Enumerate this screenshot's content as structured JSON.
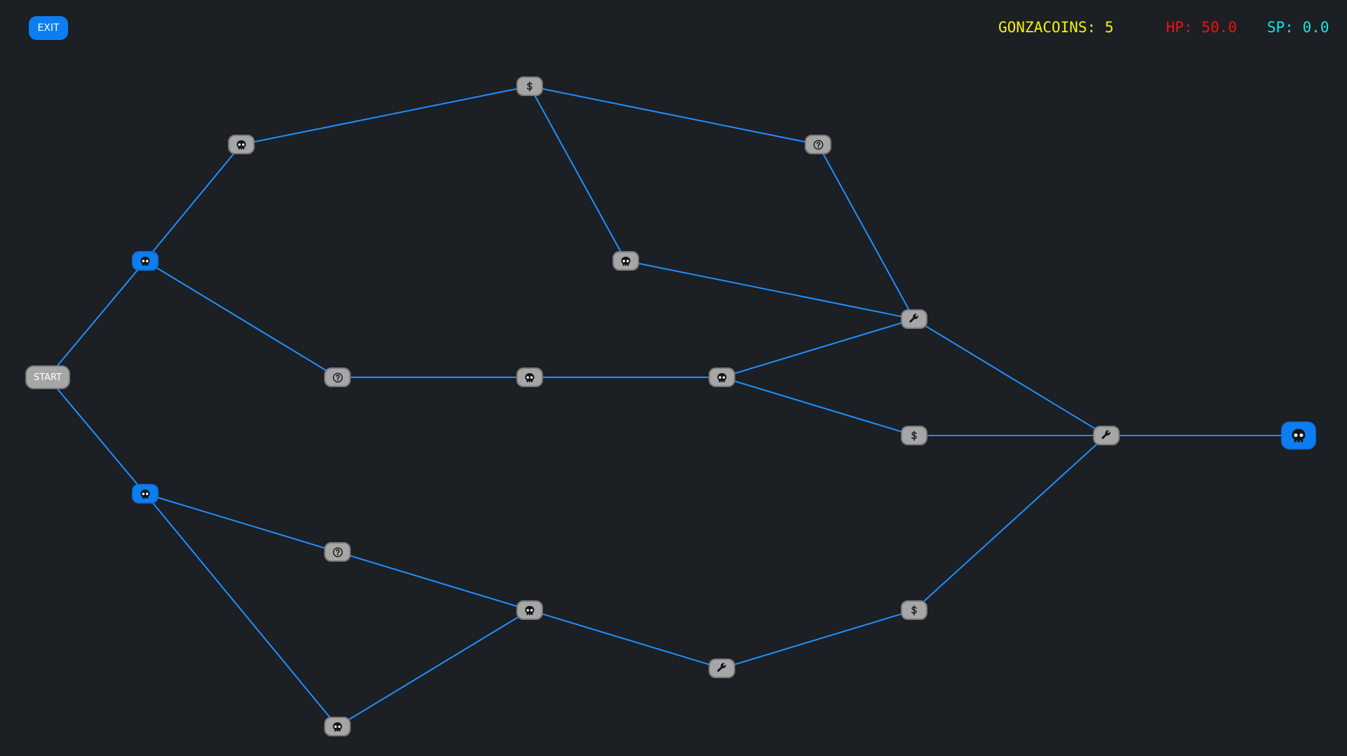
{
  "exit_label": "EXIT",
  "hud": {
    "coins": "GONZACOINS: 5",
    "hp": "HP: 50.0",
    "sp": "SP: 0.0"
  },
  "colors": {
    "background": "#1c1f24",
    "edge": "#1e90ff",
    "node_default": "#a6a6a6",
    "node_available": "#0d7ef2",
    "coins": "#f2f20c",
    "hp": "#ee1111",
    "sp": "#11e4e4"
  },
  "start_label": "START",
  "nodes": [
    {
      "id": "start",
      "type": "start",
      "state": "default"
    },
    {
      "id": "n1",
      "type": "skull-icon",
      "state": "available"
    },
    {
      "id": "n2",
      "type": "skull-icon",
      "state": "available"
    },
    {
      "id": "n3",
      "type": "skull-icon",
      "state": "default"
    },
    {
      "id": "n4",
      "type": "question-icon",
      "state": "default"
    },
    {
      "id": "n5",
      "type": "question-icon",
      "state": "default"
    },
    {
      "id": "n6",
      "type": "skull-icon",
      "state": "default"
    },
    {
      "id": "n7",
      "type": "dollar-icon",
      "state": "default"
    },
    {
      "id": "n8",
      "type": "skull-icon",
      "state": "default"
    },
    {
      "id": "n9",
      "type": "skull-icon",
      "state": "default"
    },
    {
      "id": "n10",
      "type": "question-icon",
      "state": "default"
    },
    {
      "id": "n11",
      "type": "skull-icon",
      "state": "default"
    },
    {
      "id": "n12",
      "type": "skull-icon",
      "state": "default"
    },
    {
      "id": "n13",
      "type": "wrench-icon",
      "state": "default"
    },
    {
      "id": "n14",
      "type": "wrench-icon",
      "state": "default"
    },
    {
      "id": "n15",
      "type": "dollar-icon",
      "state": "default"
    },
    {
      "id": "n16",
      "type": "dollar-icon",
      "state": "default"
    },
    {
      "id": "n17",
      "type": "wrench-icon",
      "state": "default"
    },
    {
      "id": "boss",
      "type": "skull-icon",
      "state": "available"
    }
  ],
  "edges": [
    [
      "start",
      "n1"
    ],
    [
      "start",
      "n2"
    ],
    [
      "n1",
      "n3"
    ],
    [
      "n1",
      "n4"
    ],
    [
      "n2",
      "n5"
    ],
    [
      "n2",
      "n6"
    ],
    [
      "n3",
      "n7"
    ],
    [
      "n4",
      "n8"
    ],
    [
      "n5",
      "n9"
    ],
    [
      "n6",
      "n9"
    ],
    [
      "n7",
      "n10"
    ],
    [
      "n7",
      "n11"
    ],
    [
      "n8",
      "n12"
    ],
    [
      "n9",
      "n13"
    ],
    [
      "n10",
      "n14"
    ],
    [
      "n11",
      "n14"
    ],
    [
      "n12",
      "n14"
    ],
    [
      "n12",
      "n15"
    ],
    [
      "n13",
      "n16"
    ],
    [
      "n14",
      "n17"
    ],
    [
      "n15",
      "n17"
    ],
    [
      "n16",
      "n17"
    ],
    [
      "n17",
      "boss"
    ]
  ]
}
